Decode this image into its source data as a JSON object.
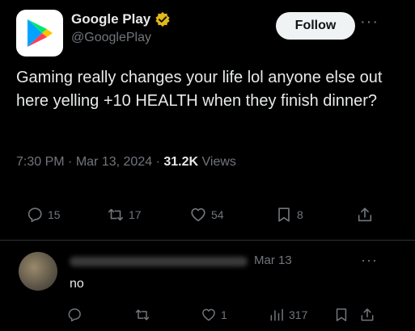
{
  "author": {
    "name": "Google Play",
    "handle": "@GooglePlay",
    "verified_icon": "gold-verified-badge-icon",
    "avatar_icon": "google-play-logo-icon",
    "follow_label": "Follow",
    "more_icon": "more-horizontal-icon"
  },
  "tweet": {
    "text": "Gaming really changes your life lol anyone else out here yelling +10 HEALTH when they finish dinner?",
    "time": "7:30 PM",
    "date": "Mar 13, 2024",
    "views_count": "31.2K",
    "views_label": "Views"
  },
  "actions": {
    "replies": "15",
    "reposts": "17",
    "likes": "54",
    "bookmarks": "8",
    "reply_icon": "reply-icon",
    "repost_icon": "repost-icon",
    "like_icon": "heart-icon",
    "bookmark_icon": "bookmark-icon",
    "share_icon": "share-icon"
  },
  "reply": {
    "date": "Mar 13",
    "text": "no",
    "likes": "1",
    "views": "317",
    "more_icon": "more-horizontal-icon"
  },
  "colors": {
    "background": "#000000",
    "text": "#e7e9ea",
    "muted": "#71767b",
    "verified_gold": "#e2b719",
    "follow_bg": "#eff3f4"
  }
}
